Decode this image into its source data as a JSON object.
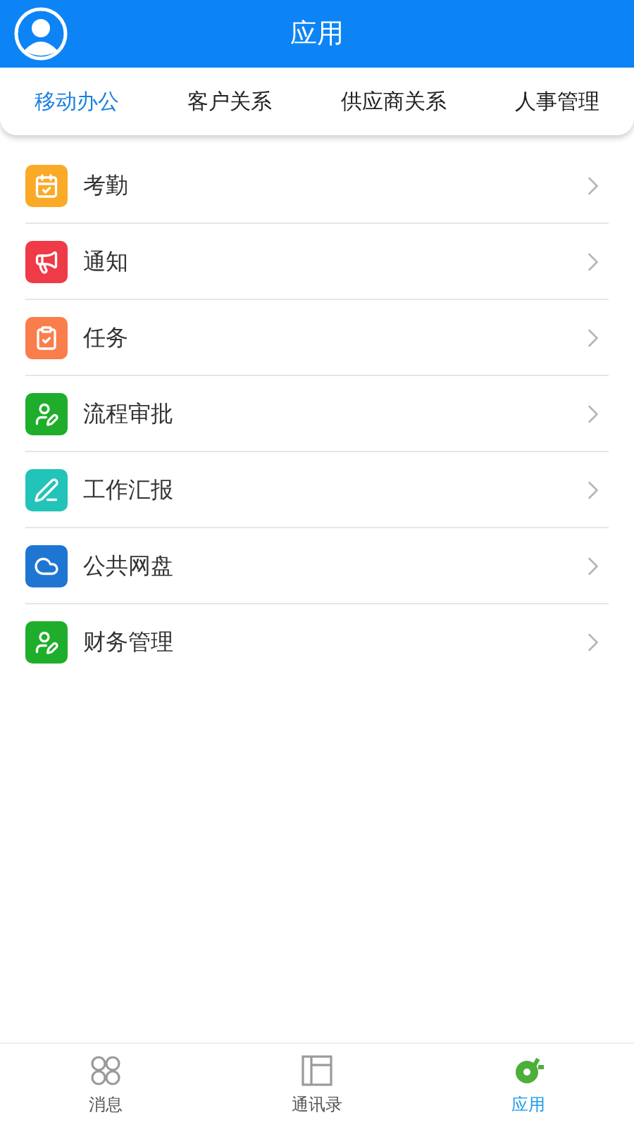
{
  "header": {
    "title": "应用"
  },
  "tabs": [
    {
      "label": "移动办公",
      "selected": true
    },
    {
      "label": "客户关系",
      "selected": false
    },
    {
      "label": "供应商关系",
      "selected": false
    },
    {
      "label": "人事管理",
      "selected": false
    }
  ],
  "items": [
    {
      "label": "考勤",
      "kind": "calendar",
      "color": "#fbaa28"
    },
    {
      "label": "通知",
      "kind": "megaphone",
      "color": "#ef3a48"
    },
    {
      "label": "任务",
      "kind": "clipboard",
      "color": "#fa7d4c"
    },
    {
      "label": "流程审批",
      "kind": "user-pen",
      "color": "#1fae2b"
    },
    {
      "label": "工作汇报",
      "kind": "pen",
      "color": "#22c3b8"
    },
    {
      "label": "公共网盘",
      "kind": "cloud",
      "color": "#1f76d2"
    },
    {
      "label": "财务管理",
      "kind": "user-pen",
      "color": "#1fae2b"
    }
  ],
  "nav": [
    {
      "label": "消息",
      "kind": "circles",
      "selected": false
    },
    {
      "label": "通讯录",
      "kind": "panel",
      "selected": false
    },
    {
      "label": "应用",
      "kind": "plug",
      "selected": true
    }
  ]
}
